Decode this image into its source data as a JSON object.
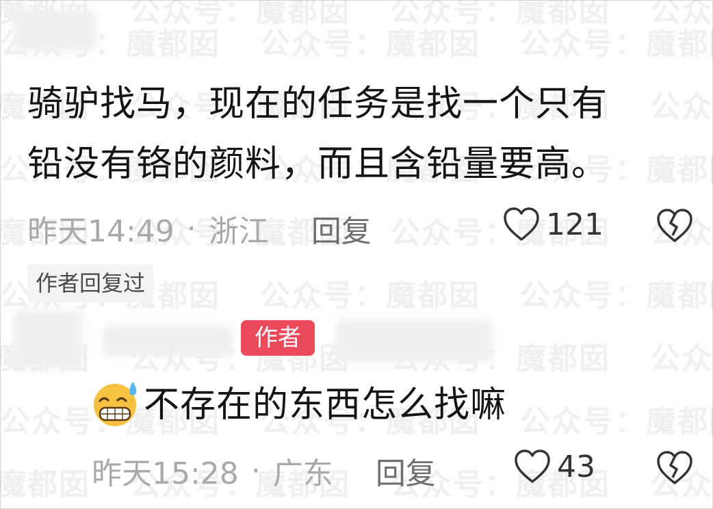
{
  "watermark_text": "公众号：魔都囡",
  "comment": {
    "text_line1": "骑驴找马，现在的任务是找一个只有",
    "text_line2": "铅没有铬的颜料，而且含铅量要高。",
    "time": "昨天14:49",
    "separator": "·",
    "location": "浙江",
    "reply_label": "回复",
    "like_count": "121",
    "author_replied_label": "作者回复过"
  },
  "reply": {
    "author_badge": "作者",
    "emoji": "sweat-grin-emoji",
    "text": "不存在的东西怎么找嘛",
    "time": "昨天15:28",
    "separator": "·",
    "location": "广东",
    "reply_label": "回复",
    "like_count": "43"
  },
  "colors": {
    "author_badge": "#ea4a5a",
    "meta_text": "#a9a9a9"
  }
}
